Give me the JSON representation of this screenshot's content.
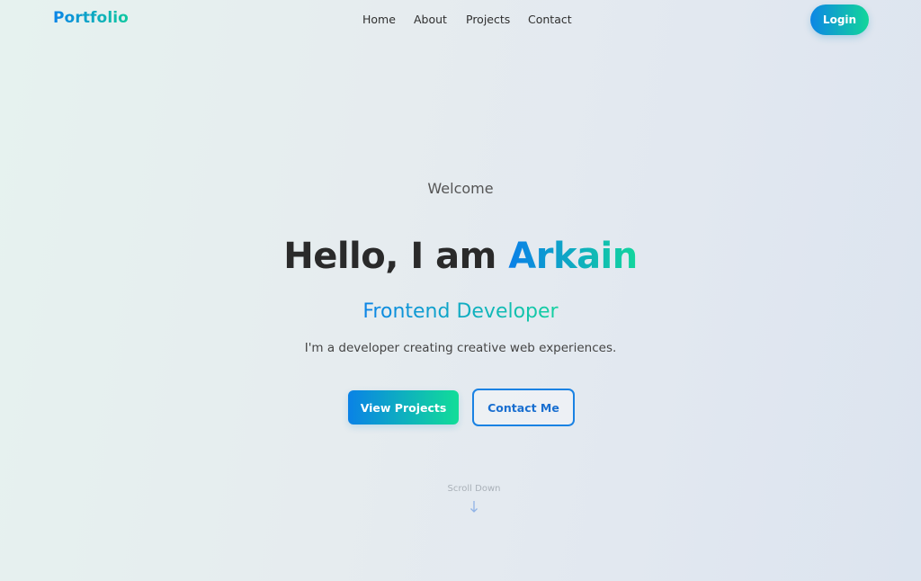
{
  "brand": {
    "logo": "Portfolio"
  },
  "nav": {
    "home": "Home",
    "about": "About",
    "projects": "Projects",
    "contact": "Contact",
    "login": "Login"
  },
  "hero": {
    "welcome": "Welcome",
    "greeting": "Hello, I am ",
    "name": "Arkain",
    "role": "Frontend Developer",
    "tagline": "I'm a developer creating creative web experiences.",
    "primary_cta": "View Projects",
    "secondary_cta": "Contact Me",
    "scroll_label": "Scroll Down",
    "scroll_icon": "arrow-down-icon"
  },
  "colors": {
    "accent_start": "#0a84e8",
    "accent_end": "#13d69c",
    "text_dark": "#2a2a2a",
    "outline_blue": "#1a82e3"
  }
}
